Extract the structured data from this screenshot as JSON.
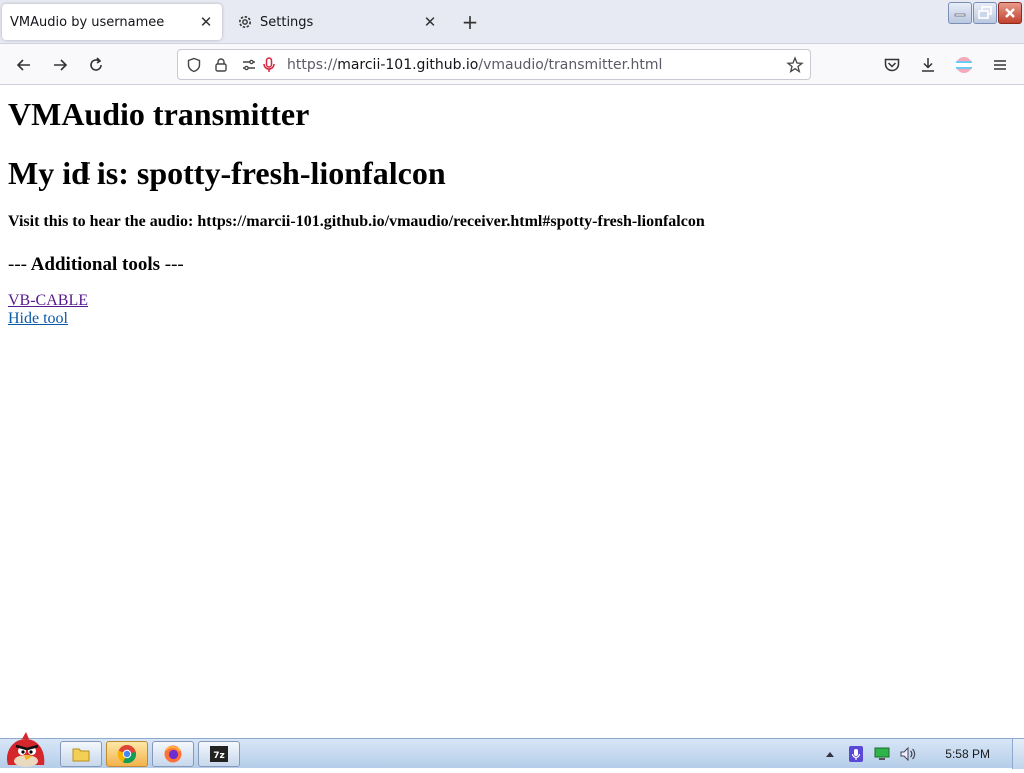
{
  "browser": {
    "tabs": [
      {
        "title": "VMAudio by usernamee",
        "active": true
      },
      {
        "title": "Settings",
        "active": false
      }
    ],
    "url": {
      "scheme": "https://",
      "host": "marcii-101.github.io",
      "path": "/vmaudio/transmitter.html"
    }
  },
  "page": {
    "title": "VMAudio transmitter",
    "id_line": "My id is: spotty-fresh-lionfalcon",
    "visit_line": "Visit this to hear the audio: https://marcii-101.github.io/vmaudio/receiver.html#spotty-fresh-lionfalcon",
    "tools_heading": {
      "prefix": "---",
      "label": "Additional tools",
      "suffix": "---"
    },
    "links": [
      "VB-CABLE",
      "Hide tool"
    ]
  },
  "taskbar": {
    "clock": "5:58 PM",
    "colors": {
      "accent": "#c2412d",
      "link_visited": "#551a8b",
      "link": "#0b58a6"
    }
  }
}
